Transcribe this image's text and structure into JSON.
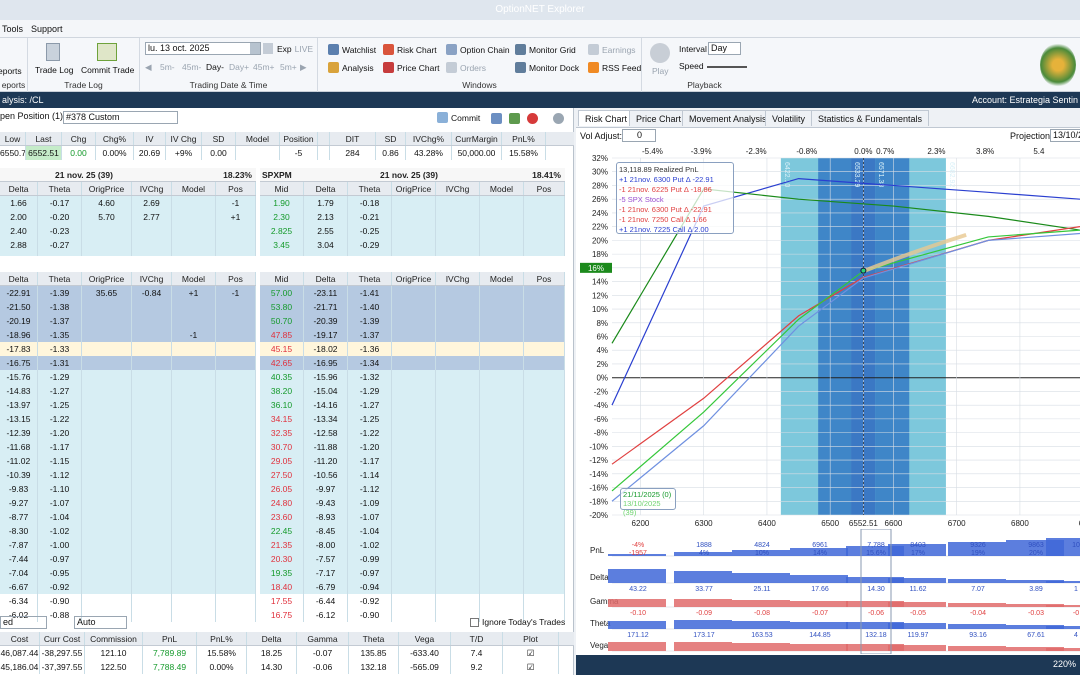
{
  "title": "OptionNET Explorer",
  "menu": [
    "Tools",
    "Support"
  ],
  "ribbon": {
    "reports": [
      "eports",
      "eports"
    ],
    "trade_log_btn": "Trade Log",
    "commit_trade_btn": "Commit Trade",
    "trade_log_group": "Trade Log",
    "date_value": "lu. 13 oct. 2025",
    "exp_label": "Exp",
    "live_label": "LIVE",
    "nav_steps": [
      "5m-",
      "45m-",
      "Day-",
      "Day+",
      "45m+",
      "5m+"
    ],
    "date_group": "Trading Date & Time",
    "windows": [
      "Watchlist",
      "Risk Chart",
      "Option Chain",
      "Monitor Grid",
      "Earnings",
      "Analysis",
      "Price Chart",
      "Orders",
      "Monitor Dock",
      "RSS Feed"
    ],
    "windows_group": "Windows",
    "play": "Play",
    "interval_label": "Interval",
    "interval_value": "Day",
    "speed_label": "Speed",
    "playback_group": "Playback"
  },
  "address": {
    "left": "alysis: /CL",
    "right": "Account: Estrategia Sentin"
  },
  "position": {
    "label": "pen Position (1)",
    "value": "#378 Custom",
    "commit": "Commit"
  },
  "summary": {
    "left_headers": [
      "Low",
      "Last",
      "Chg",
      "Chg%",
      "IV",
      "IV Chg",
      "SD",
      "Model",
      "Position"
    ],
    "left_values": [
      "6550.78",
      "6552.51",
      "0.00",
      "0.00%",
      "20.69",
      "+9%",
      "0.00",
      "",
      "-5"
    ],
    "right_headers": [
      "DIT",
      "SD",
      "IVChg%",
      "CurrMargin",
      "PnL%"
    ],
    "right_values": [
      "284",
      "0.86",
      "43.28%",
      "50,000.00",
      "15.58%"
    ]
  },
  "chain_top": {
    "left_expiry": "21 nov. 25 (39)",
    "left_pct": "18.23%",
    "symbol": "SPXPM",
    "right_expiry": "21 nov. 25 (39)",
    "right_pct": "18.41%",
    "left_headers": [
      "Delta",
      "Theta",
      "OrigPrice",
      "IVChg",
      "Model",
      "Pos"
    ],
    "right_headers": [
      "Mid",
      "Delta",
      "Theta",
      "OrigPrice",
      "IVChg",
      "Model",
      "Pos"
    ],
    "left_rows": [
      [
        "1.66",
        "-0.17",
        "4.60",
        "2.69",
        "",
        "-1"
      ],
      [
        "2.00",
        "-0.20",
        "5.70",
        "2.77",
        "",
        "+1"
      ],
      [
        "2.40",
        "-0.23",
        "",
        "",
        "",
        ""
      ],
      [
        "2.88",
        "-0.27",
        "",
        "",
        "",
        ""
      ],
      [
        "3.49",
        "-0.32",
        "",
        "",
        "",
        ""
      ]
    ],
    "right_rows": [
      [
        "1.90",
        "1.79",
        "-0.18"
      ],
      [
        "2.30",
        "2.13",
        "-0.21"
      ],
      [
        "2.825",
        "2.55",
        "-0.25"
      ],
      [
        "3.45",
        "3.04",
        "-0.29"
      ],
      [
        "4.30",
        "3.68",
        "-0.34"
      ]
    ]
  },
  "chain_bottom": {
    "left_headers": [
      "Delta",
      "Theta",
      "OrigPrice",
      "IVChg",
      "Model",
      "Pos"
    ],
    "right_headers": [
      "Mid",
      "Delta",
      "Theta",
      "OrigPrice",
      "IVChg",
      "Model",
      "Pos"
    ],
    "left_rows": [
      [
        "-22.91",
        "-1.39",
        "35.65",
        "-0.84",
        "+1",
        "-1"
      ],
      [
        "-21.50",
        "-1.38",
        "",
        "",
        "",
        ""
      ],
      [
        "-20.19",
        "-1.37",
        "",
        "",
        "",
        ""
      ],
      [
        "-18.96",
        "-1.35",
        "",
        "",
        "-1",
        ""
      ],
      [
        "-17.83",
        "-1.33",
        "",
        "",
        "",
        ""
      ],
      [
        "-16.75",
        "-1.31",
        "",
        "",
        "",
        ""
      ],
      [
        "-15.76",
        "-1.29",
        "",
        "",
        "",
        ""
      ],
      [
        "-14.83",
        "-1.27",
        "",
        "",
        "",
        ""
      ],
      [
        "-13.97",
        "-1.25",
        "",
        "",
        "",
        ""
      ],
      [
        "-13.15",
        "-1.22",
        "",
        "",
        "",
        ""
      ],
      [
        "-12.39",
        "-1.20",
        "",
        "",
        "",
        ""
      ],
      [
        "-11.68",
        "-1.17",
        "",
        "",
        "",
        ""
      ],
      [
        "-11.02",
        "-1.15",
        "",
        "",
        "",
        ""
      ],
      [
        "-10.39",
        "-1.12",
        "",
        "",
        "",
        ""
      ],
      [
        "-9.83",
        "-1.10",
        "",
        "",
        "",
        ""
      ],
      [
        "-9.27",
        "-1.07",
        "",
        "",
        "",
        ""
      ],
      [
        "-8.77",
        "-1.04",
        "",
        "",
        "",
        ""
      ],
      [
        "-8.30",
        "-1.02",
        "",
        "",
        "",
        ""
      ],
      [
        "-7.87",
        "-1.00",
        "",
        "",
        "",
        ""
      ],
      [
        "-7.44",
        "-0.97",
        "",
        "",
        "",
        ""
      ],
      [
        "-7.04",
        "-0.95",
        "",
        "",
        "",
        ""
      ],
      [
        "-6.67",
        "-0.92",
        "",
        "",
        "",
        ""
      ],
      [
        "-6.34",
        "-0.90",
        "",
        "",
        "",
        ""
      ],
      [
        "-6.02",
        "-0.88",
        "",
        "",
        "",
        ""
      ],
      [
        "-5.71",
        "-0.86",
        "",
        "",
        "",
        ""
      ]
    ],
    "right_rows": [
      [
        "57.00",
        "-23.11",
        "-1.41"
      ],
      [
        "53.80",
        "-21.71",
        "-1.40"
      ],
      [
        "50.70",
        "-20.39",
        "-1.39"
      ],
      [
        "47.85",
        "-19.17",
        "-1.37"
      ],
      [
        "45.15",
        "-18.02",
        "-1.36"
      ],
      [
        "42.65",
        "-16.95",
        "-1.34"
      ],
      [
        "40.35",
        "-15.96",
        "-1.32"
      ],
      [
        "38.20",
        "-15.04",
        "-1.29"
      ],
      [
        "36.10",
        "-14.16",
        "-1.27"
      ],
      [
        "34.15",
        "-13.34",
        "-1.25"
      ],
      [
        "32.35",
        "-12.58",
        "-1.22"
      ],
      [
        "30.70",
        "-11.88",
        "-1.20"
      ],
      [
        "29.05",
        "-11.20",
        "-1.17"
      ],
      [
        "27.50",
        "-10.56",
        "-1.14"
      ],
      [
        "26.05",
        "-9.97",
        "-1.12"
      ],
      [
        "24.80",
        "-9.43",
        "-1.09"
      ],
      [
        "23.60",
        "-8.93",
        "-1.07"
      ],
      [
        "22.45",
        "-8.45",
        "-1.04"
      ],
      [
        "21.35",
        "-8.00",
        "-1.02"
      ],
      [
        "20.30",
        "-7.57",
        "-0.99"
      ],
      [
        "19.35",
        "-7.17",
        "-0.97"
      ],
      [
        "18.40",
        "-6.79",
        "-0.94"
      ],
      [
        "17.55",
        "-6.44",
        "-0.92"
      ],
      [
        "16.75",
        "-6.12",
        "-0.90"
      ],
      [
        "16.05",
        "-5.82",
        "-0.88"
      ]
    ]
  },
  "bottom": {
    "sel1": "ed",
    "sel2": "Auto",
    "ignore_label": "Ignore Today's Trades",
    "headers": [
      "Cost",
      "Curr Cost",
      "Commission",
      "PnL",
      "PnL%",
      "Delta",
      "Gamma",
      "Theta",
      "Vega",
      "T/D",
      "Plot"
    ],
    "rows": [
      [
        "46,087.44",
        "-38,297.55",
        "121.10",
        "7,789.89",
        "15.58%",
        "18.25",
        "-0.07",
        "135.85",
        "-633.40",
        "7.4"
      ],
      [
        "45,186.04",
        "-37,397.55",
        "122.50",
        "7,788.49",
        "0.00%",
        "14.30",
        "-0.06",
        "132.18",
        "-565.09",
        "9.2"
      ]
    ]
  },
  "right_panel": {
    "tabs": [
      "Risk Chart",
      "Price Chart",
      "Movement Analysis",
      "Volatility",
      "Statistics & Fundamentals"
    ],
    "vol_adjust_label": "Vol Adjust:",
    "vol_adjust_value": "0",
    "projection_label": "Projection",
    "projection_value": "13/10/2",
    "top_axis": [
      "-5.4%",
      "-3.9%",
      "-2.3%",
      "-0.8%",
      "0.0%",
      "0.7%",
      "2.3%",
      "3.8%",
      "5.4"
    ],
    "y_axis": [
      "32%",
      "30%",
      "28%",
      "26%",
      "24%",
      "22%",
      "20%",
      "18%",
      "16%",
      "14%",
      "12%",
      "10%",
      "8%",
      "6%",
      "4%",
      "2%",
      "0%",
      "-2%",
      "-4%",
      "-6%",
      "-8%",
      "-10%",
      "-12%",
      "-14%",
      "-16%",
      "-18%",
      "-20%"
    ],
    "y_marker": "16%",
    "x_axis": [
      "6200",
      "6300",
      "6400",
      "6500",
      "6552.51",
      "6600",
      "6700",
      "6800",
      "69"
    ],
    "band_labels": [
      "6422.10",
      "6533.29",
      "6571.38",
      "6682.92"
    ],
    "legend": [
      "13,118.89 Realized PnL",
      "+1 21nov. 6300 Put Δ -22.91",
      "-1 21nov. 6225 Put Δ -18.86",
      "-5 SPX Stock",
      "-1 21nov. 6300 Put Δ -22.91",
      "-1 21nov. 7250 Call Δ 1.66",
      "+1 21nov. 7225 Call Δ 2.00"
    ],
    "date_legend": [
      "21/11/2025 (0)",
      "13/10/2025 (39)"
    ],
    "greeks": {
      "labels": [
        "PnL",
        "Delta",
        "Gamma",
        "Theta",
        "Vega"
      ],
      "pnl": [
        [
          "-4%",
          "-1957"
        ],
        [
          "1888",
          "4%"
        ],
        [
          "4824",
          "10%"
        ],
        [
          "6961",
          "14%"
        ],
        [
          "7,788",
          "15.6%"
        ],
        [
          "8403",
          "17%"
        ],
        [
          "9326",
          "19%"
        ],
        [
          "9863",
          "20%"
        ],
        [
          "10",
          ""
        ]
      ],
      "delta": [
        "43.22",
        "33.77",
        "25.11",
        "17.66",
        "14.30",
        "11.62",
        "7.07",
        "3.89",
        "1"
      ],
      "gamma": [
        "-0.10",
        "-0.09",
        "-0.08",
        "-0.07",
        "-0.06",
        "-0.05",
        "-0.04",
        "-0.03",
        "-0"
      ],
      "theta": [
        "171.12",
        "173.17",
        "163.53",
        "144.85",
        "132.18",
        "119.97",
        "93.16",
        "67.61",
        "4"
      ],
      "vega": [
        "-806.62",
        "-786.04",
        "-721.92",
        "-624.74",
        "-565.09",
        "-508.38",
        "-387.66",
        "-276.41",
        "-1"
      ]
    },
    "zoom": "220%"
  },
  "chart_data": {
    "type": "line",
    "xlabel": "",
    "ylabel": "",
    "xlim": [
      6155,
      6895
    ],
    "ylim": [
      -20,
      32
    ],
    "series": [
      {
        "color": "#2a3fd0",
        "x": [
          6155,
          6300,
          6450,
          6600,
          6750,
          6895
        ],
        "y": [
          -4,
          25,
          29,
          28,
          27,
          26
        ]
      },
      {
        "color": "#1a8a1a",
        "x": [
          6155,
          6300,
          6450,
          6600,
          6750,
          6895
        ],
        "y": [
          5,
          27.5,
          26,
          25,
          23.5,
          21.5
        ]
      },
      {
        "color": "#e04040",
        "x": [
          6155,
          6300,
          6450,
          6552,
          6750,
          6895
        ],
        "y": [
          -12.6,
          -3,
          9,
          14.6,
          20,
          22
        ]
      },
      {
        "color": "#35c73a",
        "x": [
          6155,
          6300,
          6450,
          6552,
          6750,
          6895
        ],
        "y": [
          -16.5,
          -5,
          8.5,
          15.5,
          20.5,
          21.5
        ]
      },
      {
        "color": "#6f90e0",
        "x": [
          6155,
          6300,
          6450,
          6552,
          6750,
          6895
        ],
        "y": [
          -18,
          -7,
          7.5,
          14.5,
          20,
          21
        ]
      }
    ],
    "current_price": 6552.51
  }
}
